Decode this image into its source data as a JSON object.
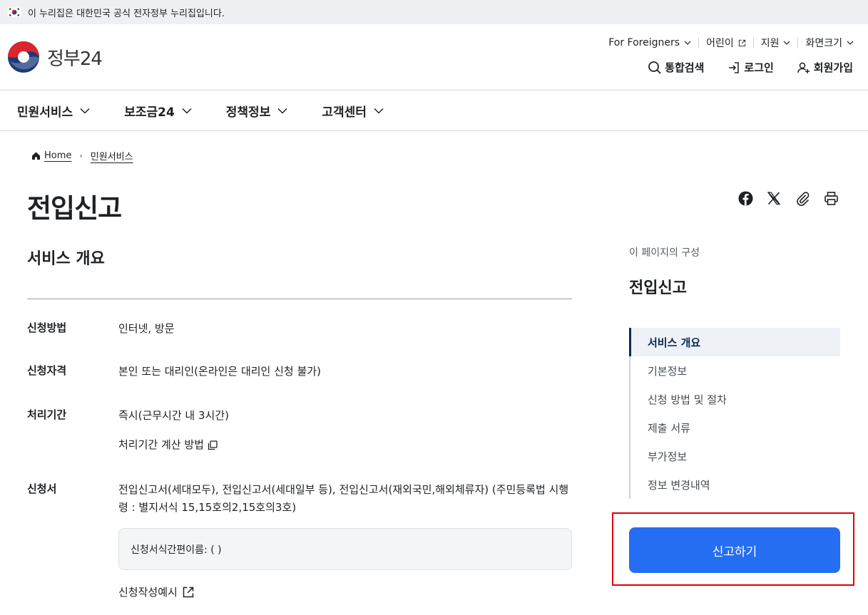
{
  "gov_banner": {
    "text": "이 누리집은 대한민국 공식 전자정부 누리집입니다."
  },
  "logo": {
    "text": "정부24"
  },
  "util": [
    {
      "label": "For Foreigners"
    },
    {
      "label": "어린이"
    },
    {
      "label": "지원"
    },
    {
      "label": "화면크기"
    }
  ],
  "auth": {
    "search": "통합검색",
    "login": "로그인",
    "signup": "회원가입"
  },
  "gnb": [
    {
      "label": "민원서비스"
    },
    {
      "label": "보조금24"
    },
    {
      "label": "정책정보"
    },
    {
      "label": "고객센터"
    }
  ],
  "breadcrumb": {
    "home": "Home",
    "current": "민원서비스"
  },
  "page": {
    "title": "전입신고"
  },
  "section": {
    "title": "서비스 개요"
  },
  "info": {
    "method": {
      "label": "신청방법",
      "value": "인터넷, 방문"
    },
    "eligibility": {
      "label": "신청자격",
      "value": "본인 또는 대리인(온라인은 대리인 신청 불가)"
    },
    "period": {
      "label": "처리기간",
      "value": "즉시(근무시간 내 3시간)",
      "link": "처리기간 계산 방법"
    },
    "form": {
      "label": "신청서",
      "value": "전입신고서(세대모두), 전입신고서(세대일부 등), 전입신고서(재외국민,해외체류자) (주민등록법 시행령 : 별지서식 15,15호의2,15호의3호)",
      "box": "신청서식간편이름: ( )",
      "example": "신청작성예시"
    }
  },
  "toc": {
    "caption": "이 페이지의 구성",
    "title": "전입신고",
    "items": [
      {
        "label": "서비스 개요"
      },
      {
        "label": "기본정보"
      },
      {
        "label": "신청 방법 및 절차"
      },
      {
        "label": "제출 서류"
      },
      {
        "label": "부가정보"
      },
      {
        "label": "정보 변경내역"
      }
    ],
    "active_index": 0
  },
  "cta": {
    "label": "신고하기"
  },
  "colors": {
    "primary": "#256ef4",
    "navy": "#052b57",
    "highlight": "#e30000"
  }
}
